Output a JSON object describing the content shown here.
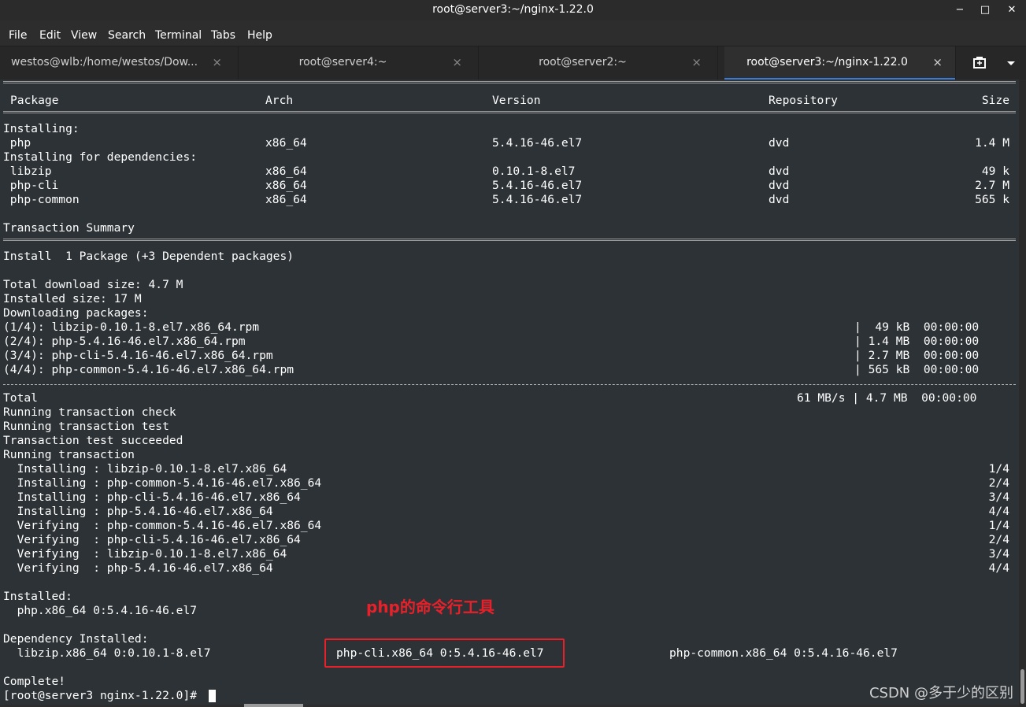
{
  "window": {
    "title": "root@server3:~/nginx-1.22.0",
    "minimize": "−",
    "maximize": "□",
    "close": "✕"
  },
  "menu": [
    "File",
    "Edit",
    "View",
    "Search",
    "Terminal",
    "Tabs",
    "Help"
  ],
  "tabs": [
    {
      "label": "westos@wlb:/home/westos/Dow..."
    },
    {
      "label": "root@server4:~"
    },
    {
      "label": "root@server2:~"
    },
    {
      "label": "root@server3:~/nginx-1.22.0",
      "active": true
    }
  ],
  "tab_close": "×",
  "new_tab_icon": "new-tab-icon",
  "tab_menu_icon": "tab-menu-icon",
  "table": {
    "headers": [
      "Package",
      "Arch",
      "Version",
      "Repository",
      "Size"
    ],
    "installing_label": "Installing:",
    "deps_label": "Installing for dependencies:",
    "rows": [
      {
        "pkg": " php",
        "arch": "x86_64",
        "ver": "5.4.16-46.el7",
        "repo": "dvd",
        "size": "1.4 M"
      },
      {
        "pkg": " libzip",
        "arch": "x86_64",
        "ver": "0.10.1-8.el7",
        "repo": "dvd",
        "size": "49 k"
      },
      {
        "pkg": " php-cli",
        "arch": "x86_64",
        "ver": "5.4.16-46.el7",
        "repo": "dvd",
        "size": "2.7 M"
      },
      {
        "pkg": " php-common",
        "arch": "x86_64",
        "ver": "5.4.16-46.el7",
        "repo": "dvd",
        "size": "565 k"
      }
    ]
  },
  "summary": {
    "title": "Transaction Summary",
    "install": "Install  1 Package (+3 Dependent packages)",
    "total_download": "Total download size: 4.7 M",
    "installed_size": "Installed size: 17 M",
    "downloading": "Downloading packages:"
  },
  "downloads": [
    {
      "file": "(1/4): libzip-0.10.1-8.el7.x86_64.rpm",
      "stat": "|  49 kB  00:00:00"
    },
    {
      "file": "(2/4): php-5.4.16-46.el7.x86_64.rpm",
      "stat": "| 1.4 MB  00:00:00"
    },
    {
      "file": "(3/4): php-cli-5.4.16-46.el7.x86_64.rpm",
      "stat": "| 2.7 MB  00:00:00"
    },
    {
      "file": "(4/4): php-common-5.4.16-46.el7.x86_64.rpm",
      "stat": "| 565 kB  00:00:00"
    }
  ],
  "total": {
    "label": "Total",
    "stat": "61 MB/s | 4.7 MB  00:00:00"
  },
  "transaction": [
    "Running transaction check",
    "Running transaction test",
    "Transaction test succeeded",
    "Running transaction"
  ],
  "steps": [
    {
      "text": "  Installing : libzip-0.10.1-8.el7.x86_64",
      "n": "1/4"
    },
    {
      "text": "  Installing : php-common-5.4.16-46.el7.x86_64",
      "n": "2/4"
    },
    {
      "text": "  Installing : php-cli-5.4.16-46.el7.x86_64",
      "n": "3/4"
    },
    {
      "text": "  Installing : php-5.4.16-46.el7.x86_64",
      "n": "4/4"
    },
    {
      "text": "  Verifying  : php-common-5.4.16-46.el7.x86_64",
      "n": "1/4"
    },
    {
      "text": "  Verifying  : php-cli-5.4.16-46.el7.x86_64",
      "n": "2/4"
    },
    {
      "text": "  Verifying  : libzip-0.10.1-8.el7.x86_64",
      "n": "3/4"
    },
    {
      "text": "  Verifying  : php-5.4.16-46.el7.x86_64",
      "n": "4/4"
    }
  ],
  "installed": {
    "label": "Installed:",
    "item": "  php.x86_64 0:5.4.16-46.el7"
  },
  "dep_installed": {
    "label": "Dependency Installed:",
    "items": [
      "  libzip.x86_64 0:0.10.1-8.el7",
      "php-cli.x86_64 0:5.4.16-46.el7",
      "php-common.x86_64 0:5.4.16-46.el7"
    ]
  },
  "complete": "Complete!",
  "prompt": "[root@server3 nginx-1.22.0]# ",
  "annotation": "php的命令行工具",
  "watermark": "CSDN @多于少的区别",
  "colors": {
    "annotation": "#e8202a",
    "tab_active_underline": "#3a7bd5",
    "terminal_bg": "#2d3236"
  }
}
